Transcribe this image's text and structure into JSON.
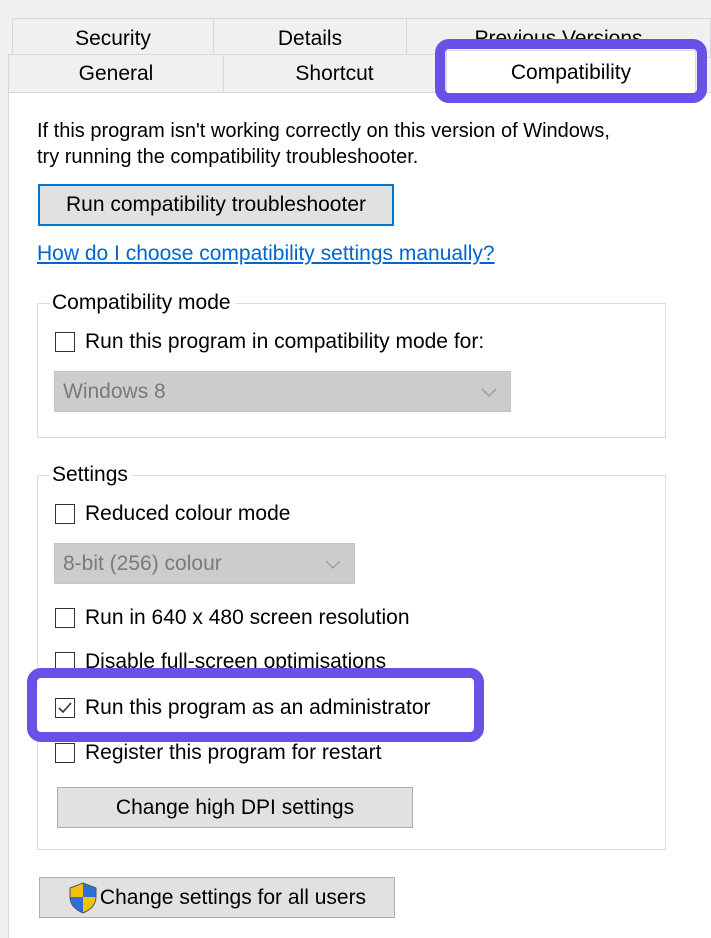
{
  "tabs": {
    "row1": [
      "Security",
      "Details",
      "Previous Versions"
    ],
    "row2": [
      "General",
      "Shortcut",
      "Compatibility"
    ]
  },
  "intro": {
    "line1": "If this program isn't working correctly on this version of Windows,",
    "line2": "try running the compatibility troubleshooter."
  },
  "troubleshooter_button": "Run compatibility troubleshooter",
  "help_link": "How do I choose compatibility settings manually?",
  "compat_mode": {
    "legend": "Compatibility mode",
    "checkbox_label": "Run this program in compatibility mode for:",
    "checked": false,
    "select_value": "Windows 8"
  },
  "settings": {
    "legend": "Settings",
    "reduced_colour": {
      "label": "Reduced colour mode",
      "checked": false
    },
    "colour_select_value": "8-bit (256) colour",
    "resolution": {
      "label": "Run in 640 x 480 screen resolution",
      "checked": false
    },
    "fullscreen": {
      "label": "Disable full-screen optimisations",
      "checked": false
    },
    "admin": {
      "label": "Run this program as an administrator",
      "checked": true
    },
    "restart": {
      "label": "Register this program for restart",
      "checked": false
    },
    "dpi_button": "Change high DPI settings"
  },
  "all_users_button": "Change settings for all users",
  "colors": {
    "highlight": "#6b50e8",
    "link": "#0066cc",
    "focus_border": "#0078d7"
  }
}
